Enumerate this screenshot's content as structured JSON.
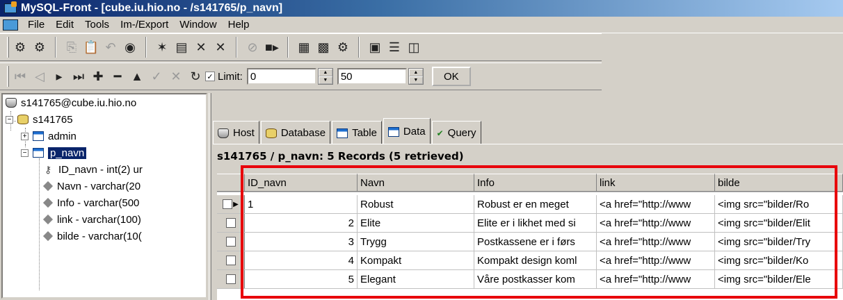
{
  "window": {
    "title": "MySQL-Front - [cube.iu.hio.no - /s141765/p_navn]"
  },
  "menu": [
    "File",
    "Edit",
    "Tools",
    "Im-/Export",
    "Window",
    "Help"
  ],
  "navbar": {
    "limit_label": "Limit:",
    "limit_checked": true,
    "offset_value": "0",
    "count_value": "50",
    "ok_label": "OK"
  },
  "tree": {
    "server": "s141765@cube.iu.hio.no",
    "database": "s141765",
    "tables": [
      "admin",
      "p_navn"
    ],
    "selected_table": "p_navn",
    "fields": [
      "ID_navn - int(2) ur",
      "Navn - varchar(20",
      "Info - varchar(500",
      "link - varchar(100)",
      "bilde - varchar(10("
    ]
  },
  "tabs": [
    "Host",
    "Database",
    "Table",
    "Data",
    "Query"
  ],
  "active_tab": "Data",
  "records_header": "s141765 / p_navn: 5 Records (5 retrieved)",
  "grid": {
    "columns": [
      "ID_navn",
      "Navn",
      "Info",
      "link",
      "bilde"
    ],
    "rows": [
      [
        "1",
        "Robust",
        "Robust er en meget",
        "<a href=\"http://www",
        "<img src=\"bilder/Ro"
      ],
      [
        "2",
        "Elite",
        "Elite er i likhet med si",
        "<a href=\"http://www",
        "<img src=\"bilder/Elit"
      ],
      [
        "3",
        "Trygg",
        "Postkassene er i førs",
        "<a href=\"http://www",
        "<img src=\"bilder/Try"
      ],
      [
        "4",
        "Kompakt",
        "Kompakt design koml",
        "<a href=\"http://www",
        "<img src=\"bilder/Ko"
      ],
      [
        "5",
        "Elegant",
        "Våre postkasser kom",
        "<a href=\"http://www",
        "<img src=\"bilder/Ele"
      ]
    ]
  },
  "colors": {
    "title_gradient_start": "#0a246a",
    "highlight_box": "#e8000b",
    "face": "#d4d0c8"
  }
}
